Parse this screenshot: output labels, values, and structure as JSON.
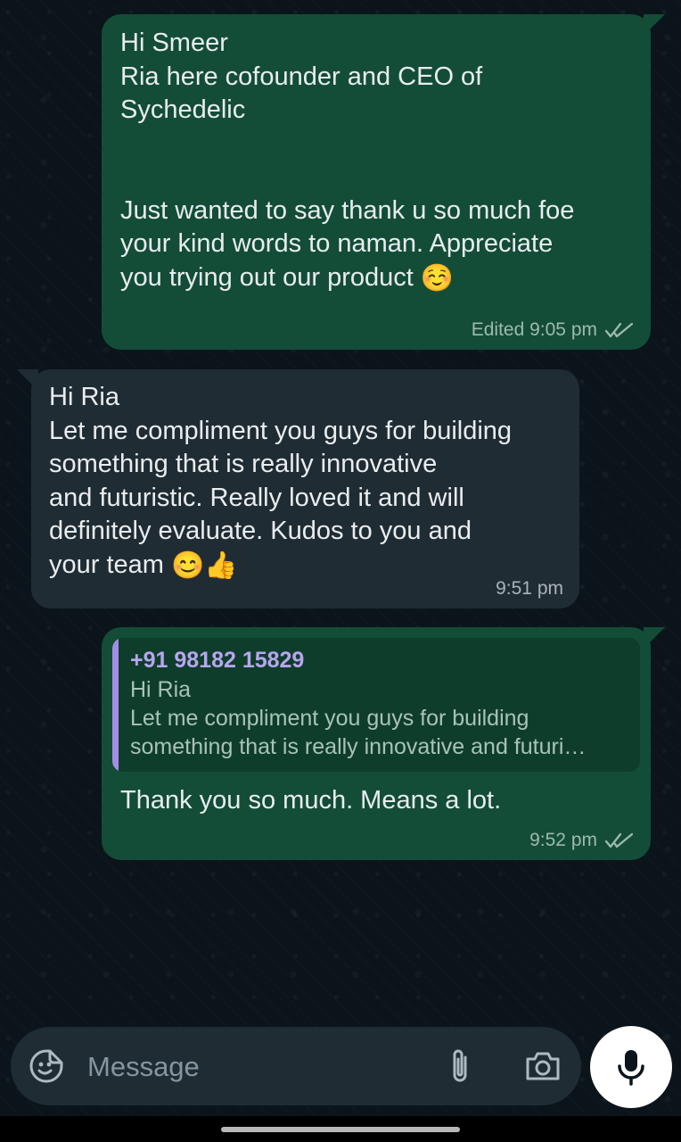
{
  "messages": [
    {
      "lines": "Hi Smeer\nRia here cofounder and CEO of\nSychedelic\n\n\nJust wanted to say thank u so much foe\nyour kind words to naman. Appreciate\nyou trying out our product",
      "emoji": "☺️",
      "meta": "Edited 9:05 pm"
    },
    {
      "lines": "Hi Ria\nLet me compliment you guys for building\nsomething that is really innovative\nand futuristic. Really loved it and will\ndefinitely evaluate. Kudos to you and\nyour team",
      "emoji": "😊👍",
      "meta": "9:51 pm"
    },
    {
      "quote_author": "+91 98182 15829",
      "quote_line1": "Hi Ria",
      "quote_line2": "Let me compliment you guys for building",
      "quote_line3": "something that is really innovative and futuri…",
      "text": "Thank you so much. Means a lot.",
      "meta": "9:52 pm"
    }
  ],
  "composer": {
    "placeholder": "Message",
    "icons": [
      "sticker-icon",
      "attach-icon",
      "camera-icon",
      "microphone-icon"
    ]
  },
  "colors": {
    "background": "#0b141a",
    "outgoing_bubble": "#134d37",
    "incoming_bubble": "#202c33",
    "quote_accent": "#a38ce6"
  }
}
